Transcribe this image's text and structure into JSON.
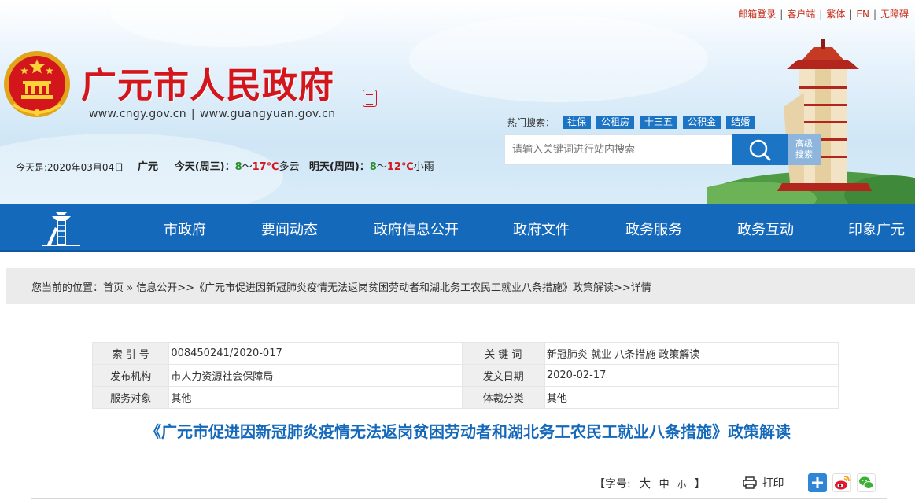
{
  "top_links": [
    "邮箱登录",
    "客户端",
    "繁体",
    "EN",
    "无障碍"
  ],
  "site": {
    "title": "广元市人民政府",
    "urls": [
      "www.cngy.gov.cn",
      "www.guangyuan.gov.cn"
    ]
  },
  "hot_search": {
    "label": "热门搜索：",
    "tags": [
      "社保",
      "公租房",
      "十三五",
      "公积金",
      "结婚"
    ]
  },
  "search": {
    "placeholder": "请输入关键词进行站内搜索",
    "advanced_label_1": "高级",
    "advanced_label_2": "搜索"
  },
  "date": {
    "label": "今天是:",
    "value": "2020年03月04日"
  },
  "weather": {
    "city": "广元",
    "today_label": "今天(周三)：",
    "today_low": "8",
    "tilde": "～",
    "today_high": "17",
    "unit": "℃",
    "today_desc": "多云",
    "tomorrow_label": "明天(周四)：",
    "tomorrow_low": "8",
    "tomorrow_high": "12",
    "tomorrow_desc": "小雨"
  },
  "nav": [
    "市政府",
    "要闻动态",
    "政府信息公开",
    "政府文件",
    "政务服务",
    "政务互动",
    "印象广元"
  ],
  "breadcrumb": "您当前的位置：首页 » 信息公开>>《广元市促进因新冠肺炎疫情无法返岗贫困劳动者和湖北务工农民工就业八条措施》政策解读>>详情",
  "info": {
    "index_label": "索 引 号",
    "index_value": "008450241/2020-017",
    "keyword_label": "关 键 词",
    "keyword_value": "新冠肺炎 就业 八条措施 政策解读",
    "issuer_label": "发布机构",
    "issuer_value": "市人力资源社会保障局",
    "date_label": "发文日期",
    "date_value": "2020-02-17",
    "audience_label": "服务对象",
    "audience_value": "其他",
    "genre_label": "体裁分类",
    "genre_value": "其他"
  },
  "article": {
    "title": "《广元市促进因新冠肺炎疫情无法返岗贫困劳动者和湖北务工农民工就业八条措施》政策解读"
  },
  "tools": {
    "fontsize_label": "【字号:",
    "size_large": "大",
    "size_medium": "中",
    "size_small": "小",
    "fontsize_close": "】",
    "print_label": "打印"
  },
  "colors": {
    "title_red": "#d2161b",
    "nav_blue": "#1569bb",
    "tag_blue": "#1c74c4",
    "link_red": "#c8321f"
  }
}
